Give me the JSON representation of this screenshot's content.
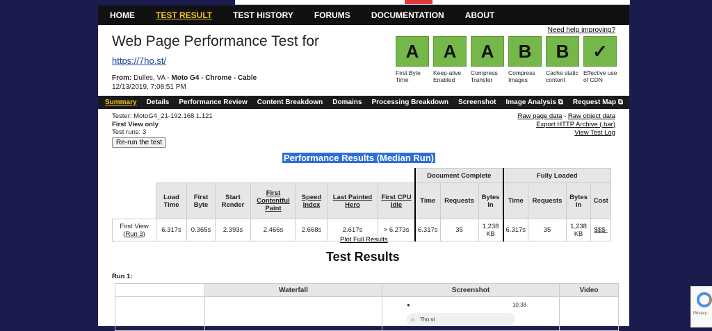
{
  "nav": [
    "HOME",
    "TEST RESULT",
    "TEST HISTORY",
    "FORUMS",
    "DOCUMENTATION",
    "ABOUT"
  ],
  "header": {
    "title": "Web Page Performance Test for",
    "url": "https://7ho.st/",
    "from_prefix": "From: ",
    "from_loc": "Dulles, VA - ",
    "from_device": "Moto G4 - Chrome - Cable",
    "date": "12/13/2019, 7:08:51 PM",
    "help": "Need help improving?"
  },
  "grades": [
    {
      "grade": "A",
      "label": "First Byte Time"
    },
    {
      "grade": "A",
      "label": "Keep-alive Enabled"
    },
    {
      "grade": "A",
      "label": "Compress Transfer"
    },
    {
      "grade": "B",
      "label": "Compress Images"
    },
    {
      "grade": "B",
      "label": "Cache static content"
    },
    {
      "grade": "✓",
      "label": "Effective use of CDN"
    }
  ],
  "subnav": [
    "Summary",
    "Details",
    "Performance Review",
    "Content Breakdown",
    "Domains",
    "Processing Breakdown",
    "Screenshot",
    "Image Analysis",
    "Request Map"
  ],
  "tester": {
    "line1": "Tester: MotoG4_21-192.168.1.121",
    "line2": "First View only",
    "line3": "Test runs: 3",
    "rerun": "Re-run the test"
  },
  "raw_links": {
    "raw_page": "Raw page data",
    "sep": " - ",
    "raw_object": "Raw object data",
    "export": "Export HTTP Archive (.har)",
    "log": "View Test Log"
  },
  "perf_title": "Performance Results (Median Run)",
  "results": {
    "group_doc": "Document Complete",
    "group_full": "Fully Loaded",
    "headers": [
      "Load Time",
      "First Byte",
      "Start Render",
      "First Contentful Paint",
      "Speed Index",
      "Last Painted Hero",
      "First CPU Idle",
      "Time",
      "Requests",
      "Bytes In",
      "Time",
      "Requests",
      "Bytes In",
      "Cost"
    ],
    "row_label": "First View",
    "row_run": "Run 3",
    "row": [
      "6.317s",
      "0.365s",
      "2.393s",
      "2.466s",
      "2.668s",
      "2.617s",
      "> 6.273s",
      "6.317s",
      "35",
      "1,238 KB",
      "6.317s",
      "35",
      "1,238 KB",
      "$$$-"
    ]
  },
  "plot_link": "Plot Full Results",
  "test_results_title": "Test Results",
  "run1": {
    "label": "Run 1:",
    "headers": [
      "Waterfall",
      "Screenshot",
      "Video"
    ],
    "phone_time": "10:38",
    "phone_url": "7ho.st"
  },
  "recaptcha": {
    "text": "Privacy -"
  }
}
